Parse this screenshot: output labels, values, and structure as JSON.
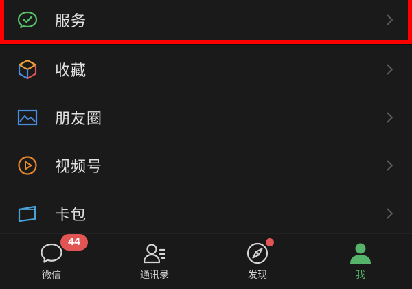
{
  "menu": {
    "items": [
      {
        "label": "服务",
        "icon": "wechat-pay-check-icon",
        "highlighted": true
      },
      {
        "label": "收藏",
        "icon": "cube-icon"
      },
      {
        "label": "朋友圈",
        "icon": "image-frame-icon"
      },
      {
        "label": "视频号",
        "icon": "play-circle-icon"
      },
      {
        "label": "卡包",
        "icon": "card-wallet-icon"
      }
    ]
  },
  "tabbar": {
    "tabs": [
      {
        "label": "微信",
        "icon": "chat-bubble-icon",
        "badge": "44"
      },
      {
        "label": "通讯录",
        "icon": "contacts-icon"
      },
      {
        "label": "发现",
        "icon": "compass-icon",
        "dot": true
      },
      {
        "label": "我",
        "icon": "profile-icon",
        "active": true
      }
    ]
  },
  "colors": {
    "background": "#111111",
    "row_background": "#1a1a1a",
    "highlight_border": "#ff0000",
    "active_green": "#56b36a",
    "badge_red": "#e25555",
    "service_icon": "#56c06a",
    "collect_orange": "#f0a23a",
    "collect_blue": "#4a8de0",
    "moments_blue": "#4a8de0",
    "channels_orange": "#e8892f",
    "cards_blue": "#4aa3d8"
  }
}
